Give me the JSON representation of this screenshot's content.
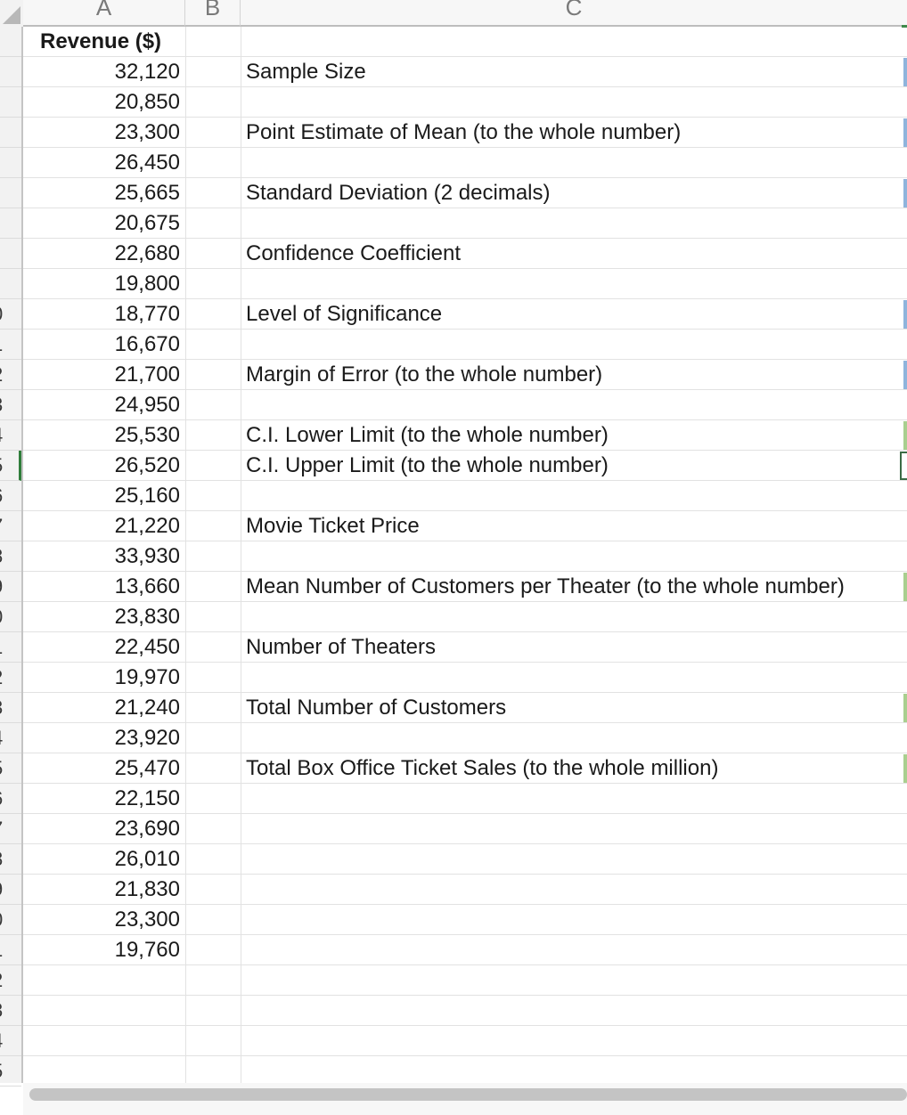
{
  "columns": [
    {
      "letter": "A"
    },
    {
      "letter": "B"
    },
    {
      "letter": "C"
    }
  ],
  "row_numbers": [
    "",
    "",
    "",
    "",
    "",
    "",
    "",
    "",
    "",
    "0",
    "1",
    "2",
    "3",
    "4",
    "5",
    "6",
    "7",
    "8",
    "9",
    "0",
    "1",
    "2",
    "3",
    "4",
    "5",
    "6",
    "7",
    "8",
    "9",
    "0",
    "1",
    "2",
    "3",
    "4",
    "5"
  ],
  "selected_row_index": 14,
  "col_a": [
    "Revenue ($)",
    "32,120",
    "20,850",
    "23,300",
    "26,450",
    "25,665",
    "20,675",
    "22,680",
    "19,800",
    "18,770",
    "16,670",
    "21,700",
    "24,950",
    "25,530",
    "26,520",
    "25,160",
    "21,220",
    "33,930",
    "13,660",
    "23,830",
    "22,450",
    "19,970",
    "21,240",
    "23,920",
    "25,470",
    "22,150",
    "23,690",
    "26,010",
    "21,830",
    "23,300",
    "19,760"
  ],
  "col_c": [
    {
      "row": 1,
      "text": "Sample Size",
      "mark": "blue"
    },
    {
      "row": 3,
      "text": "Point Estimate of Mean (to the whole number)",
      "mark": "blue"
    },
    {
      "row": 5,
      "text": "Standard Deviation (2 decimals)",
      "mark": "blue"
    },
    {
      "row": 7,
      "text": "Confidence Coefficient",
      "mark": ""
    },
    {
      "row": 9,
      "text": "Level of Significance",
      "mark": "blue"
    },
    {
      "row": 11,
      "text": "Margin of Error (to the whole number)",
      "mark": "blue"
    },
    {
      "row": 13,
      "text": "C.I. Lower Limit (to the whole number)",
      "mark": "green"
    },
    {
      "row": 14,
      "text": "C.I. Upper Limit (to the whole number)",
      "mark": "selected"
    },
    {
      "row": 16,
      "text": "Movie Ticket Price",
      "mark": ""
    },
    {
      "row": 18,
      "text": "Mean Number of Customers per Theater (to the whole number)",
      "mark": "green"
    },
    {
      "row": 20,
      "text": "Number of Theaters",
      "mark": ""
    },
    {
      "row": 22,
      "text": "Total Number of Customers",
      "mark": "green"
    },
    {
      "row": 24,
      "text": "Total Box Office Ticket Sales (to the whole million)",
      "mark": "green"
    }
  ]
}
